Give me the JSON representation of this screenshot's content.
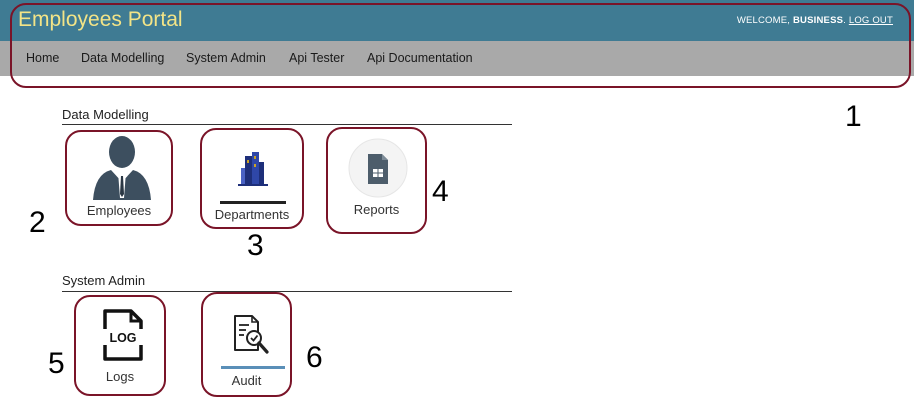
{
  "header": {
    "title": "Employees Portal",
    "welcome_prefix": "WELCOME, ",
    "welcome_user": "BUSINESS",
    "welcome_suffix": ". ",
    "logout": "LOG OUT"
  },
  "nav": {
    "items": [
      {
        "label": "Home"
      },
      {
        "label": "Data Modelling"
      },
      {
        "label": "System Admin"
      },
      {
        "label": "Api Tester"
      },
      {
        "label": "Api Documentation"
      }
    ]
  },
  "sections": {
    "data_modelling": {
      "title": "Data Modelling",
      "tiles": [
        {
          "label": "Employees",
          "icon": "person-icon"
        },
        {
          "label": "Departments",
          "icon": "building-icon"
        },
        {
          "label": "Reports",
          "icon": "spreadsheet-icon"
        }
      ]
    },
    "system_admin": {
      "title": "System Admin",
      "tiles": [
        {
          "label": "Logs",
          "icon": "log-file-icon"
        },
        {
          "label": "Audit",
          "icon": "audit-document-icon"
        }
      ]
    }
  },
  "annotations": [
    "1",
    "2",
    "3",
    "4",
    "5",
    "6"
  ],
  "colors": {
    "header_bg": "#3f7b93",
    "title_color": "#f3e487",
    "nav_bg": "#a9a9a9",
    "annotation_border": "#7a1428"
  }
}
